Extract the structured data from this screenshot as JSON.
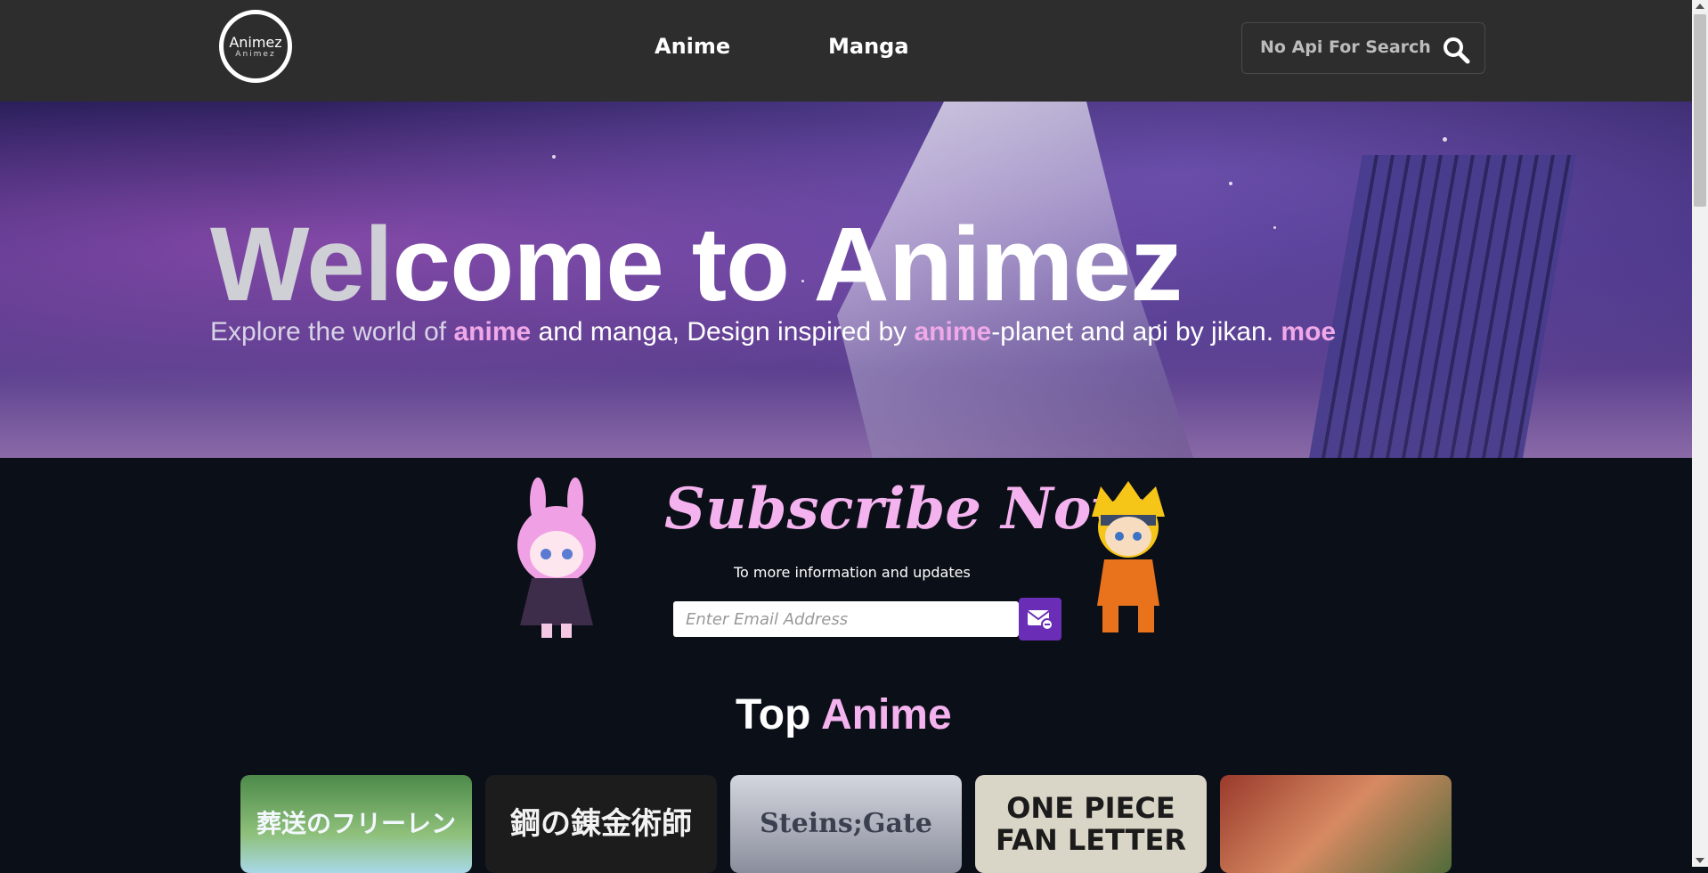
{
  "brand": {
    "logo_line1": "Animez",
    "logo_line2": "Animez"
  },
  "nav": {
    "anime": "Anime",
    "manga": "Manga"
  },
  "search": {
    "placeholder": "No Api For Search",
    "icon": "search-icon"
  },
  "hero": {
    "title_part1": "Wel",
    "title_part2": "come to Animez",
    "sub_1": "Explore the world of ",
    "sub_2": "anime",
    "sub_3": " and manga, Design inspired by ",
    "sub_4": "anime",
    "sub_5": "-planet and api by jikan. ",
    "sub_6": "moe"
  },
  "subscribe": {
    "title": "Subscribe Now",
    "text": "To more information and updates",
    "email_placeholder": "Enter Email Address",
    "button_icon": "mail-icon"
  },
  "top_anime": {
    "title_1": "Top ",
    "title_2": "Anime",
    "cards": [
      {
        "text": "葬送のフリーレン"
      },
      {
        "text": "鋼の錬金術師"
      },
      {
        "text": "Steins;Gate"
      },
      {
        "text": "ONE PIECE FAN LETTER"
      },
      {
        "text": ""
      }
    ]
  },
  "colors": {
    "accent_pink": "#f4b2ee",
    "header_bg": "#2d2d2d",
    "page_bg": "#0b0f17",
    "button_purple": "#6a2db5"
  }
}
